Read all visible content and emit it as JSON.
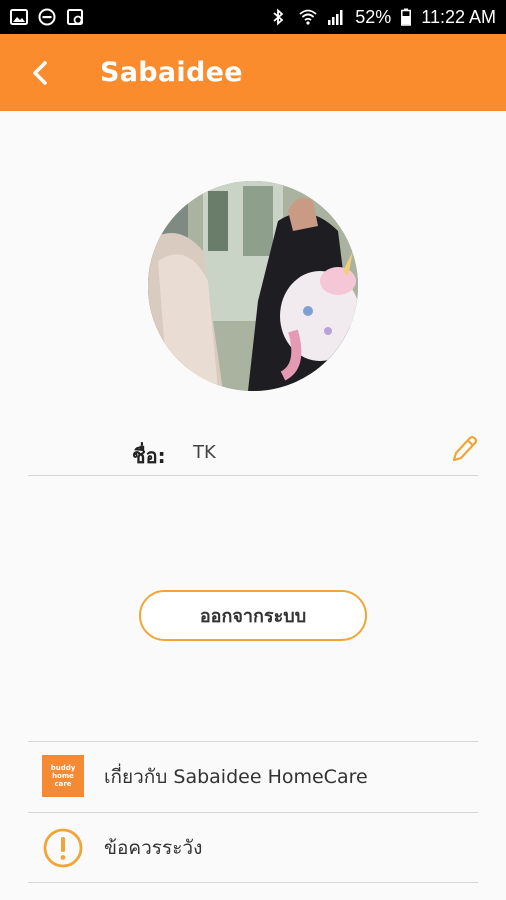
{
  "status_bar": {
    "battery": "52%",
    "time": "11:22 AM"
  },
  "app_bar": {
    "title": "Sabaidee"
  },
  "profile": {
    "name_label": "ชื่อ:",
    "name_value": "TK"
  },
  "logout": {
    "label": "ออกจากระบบ"
  },
  "menu": {
    "items": [
      {
        "label": "เกี่ยวกับ Sabaidee HomeCare",
        "icon": "buddy-homecare-logo"
      },
      {
        "label": "ข้อควรระวัง",
        "icon": "warning-icon"
      }
    ]
  },
  "logo": {
    "lines": [
      "buddy",
      "home",
      "care"
    ]
  },
  "colors": {
    "accent": "#fb8c2e",
    "button_border": "#f0a537"
  }
}
